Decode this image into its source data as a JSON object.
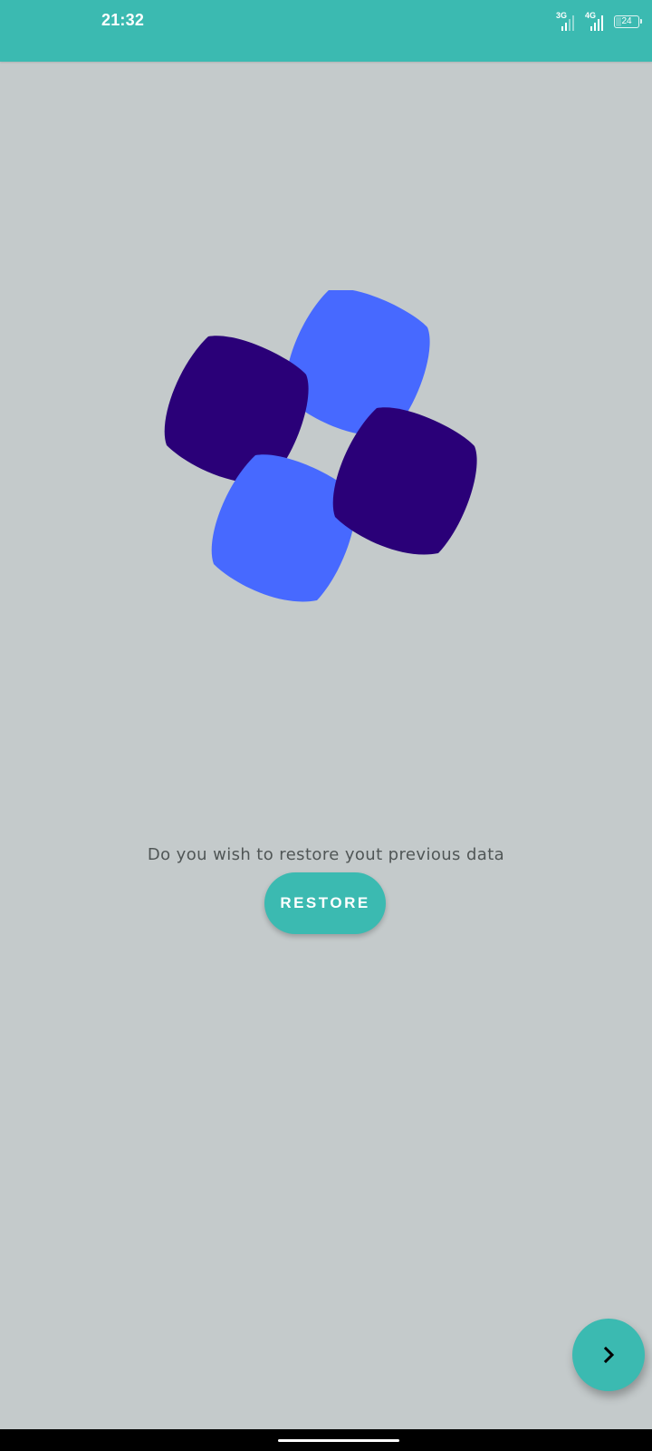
{
  "status_bar": {
    "time": "21:32",
    "network_1": "3G",
    "network_2": "4G",
    "battery_level": "24",
    "battery_fraction": 0.24
  },
  "restore": {
    "prompt": "Do you wish to restore yout previous data",
    "button_label": "RESTORE"
  },
  "icons": {
    "logo": "app-logo-icon",
    "next": "chevron-right-icon"
  },
  "colors": {
    "accent": "#3bbab1",
    "background": "#c4cacb",
    "logo_dark": "#2a0078",
    "logo_light": "#4769ff",
    "text": "#505656"
  }
}
